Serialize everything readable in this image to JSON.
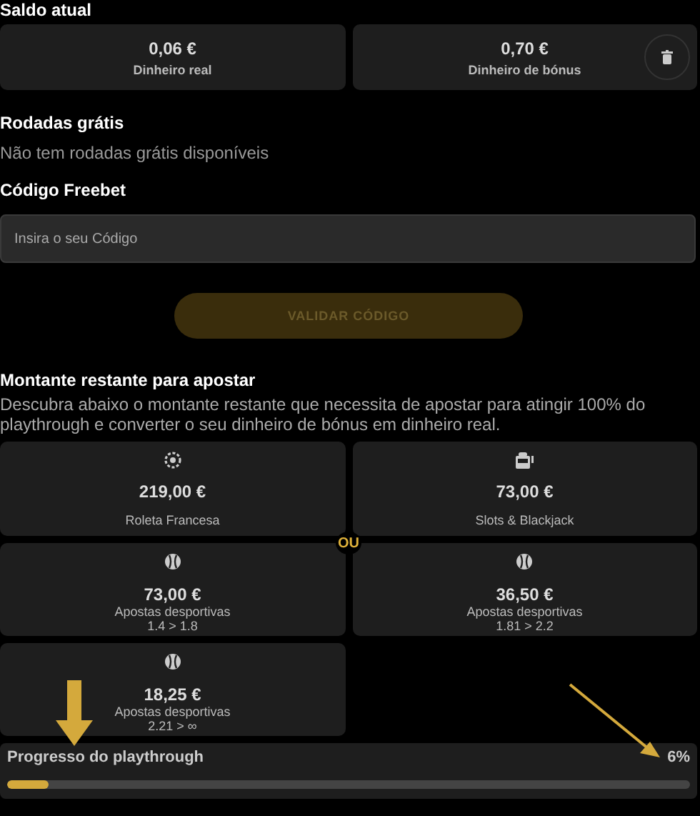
{
  "balance": {
    "title": "Saldo atual",
    "cards": [
      {
        "amount": "0,06 €",
        "label": "Dinheiro real",
        "deletable": false
      },
      {
        "amount": "0,70 €",
        "label": "Dinheiro de bónus",
        "deletable": true
      }
    ]
  },
  "free_spins": {
    "title": "Rodadas grátis",
    "message": "Não tem rodadas grátis disponíveis"
  },
  "freebet": {
    "title": "Código Freebet",
    "placeholder": "Insira o seu Código",
    "button": "VALIDAR CÓDIGO",
    "button_disabled": true
  },
  "wagering": {
    "title": "Montante restante para apostar",
    "description": "Descubra abaixo o montante restante que necessita de apostar para atingir 100% do playthrough e converter o seu dinheiro de bónus em dinheiro real.",
    "separator": "OU",
    "cards": [
      {
        "kind": "roulette",
        "amount": "219,00 €",
        "label": "Roleta Francesa"
      },
      {
        "kind": "slots",
        "amount": "73,00 €",
        "label": "Slots & Blackjack"
      },
      {
        "kind": "sports",
        "amount": "73,00 €",
        "label": "Apostas desportivas",
        "range": "1.4 > 1.8"
      },
      {
        "kind": "sports",
        "amount": "36,50 €",
        "label": "Apostas desportivas",
        "range": "1.81 > 2.2"
      },
      {
        "kind": "sports",
        "amount": "18,25 €",
        "label": "Apostas desportivas",
        "range": "2.21 > ∞"
      }
    ]
  },
  "progress": {
    "title": "Progresso do playthrough",
    "reading": "6%",
    "level": 0.06
  }
}
